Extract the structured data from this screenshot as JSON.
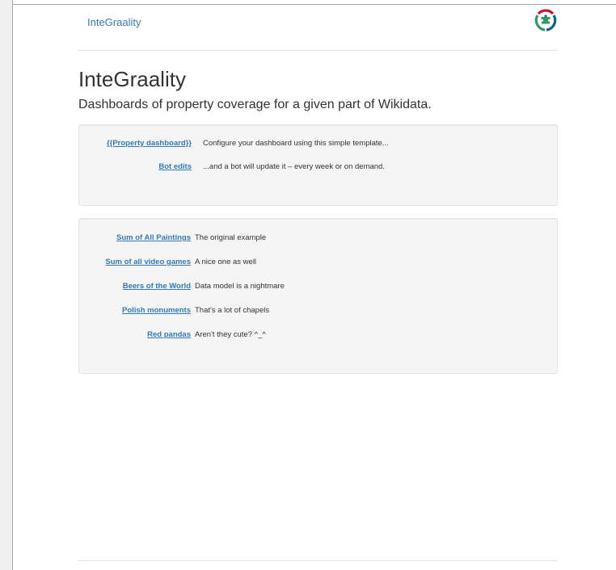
{
  "header": {
    "brand": "InteGraality",
    "logo_icon": "wikimedia-toolforge-logo-icon"
  },
  "main": {
    "title": "InteGraality",
    "lead": "Dashboards of property coverage for a given part of Wikidata."
  },
  "intro": [
    {
      "term": "{{Property dashboard}}",
      "desc": "Configure your dashboard using this simple template..."
    },
    {
      "term": "Bot edits",
      "desc": "...and a bot will update it – every week or on demand."
    }
  ],
  "examples": [
    {
      "term": "Sum of All Paintings",
      "desc": "The original example"
    },
    {
      "term": "Sum of all video games",
      "desc": "A nice one as well"
    },
    {
      "term": "Beers of the World",
      "desc": "Data model is a nightmare"
    },
    {
      "term": "Polish monuments",
      "desc": "That's a lot of chapels"
    },
    {
      "term": "Red pandas",
      "desc": "Aren't they cute? ^_^"
    }
  ],
  "colors": {
    "link": "#337ab7",
    "well_bg": "#f5f5f5",
    "text": "#333333"
  }
}
